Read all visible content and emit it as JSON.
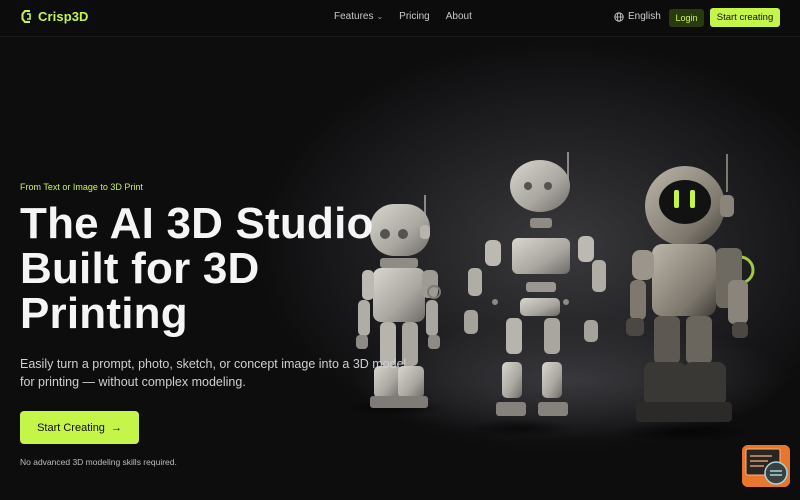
{
  "brand": {
    "name": "Crisp3D",
    "accent": "#c6f54a"
  },
  "nav": {
    "links": [
      {
        "label": "Features",
        "has_dropdown": true
      },
      {
        "label": "Pricing"
      },
      {
        "label": "About"
      }
    ],
    "language": "English",
    "login_label": "Login",
    "start_label": "Start creating"
  },
  "hero": {
    "eyebrow": "From Text or Image to 3D Print",
    "headline_lines": [
      "The AI 3D Studio",
      "Built for 3D",
      "Printing"
    ],
    "subtitle_lines": [
      "Easily turn a prompt, photo, sketch, or concept image into a 3D model",
      "for printing — without complex modeling."
    ],
    "cta_label": "Start Creating",
    "cta_icon": "arrow-right-icon",
    "note": "No advanced 3D modeling skills required."
  },
  "icons": {
    "logo": "crisp3d-logo-icon",
    "globe": "globe-icon",
    "chevron": "chevron-down-icon",
    "badge": "chat-widget-icon"
  }
}
